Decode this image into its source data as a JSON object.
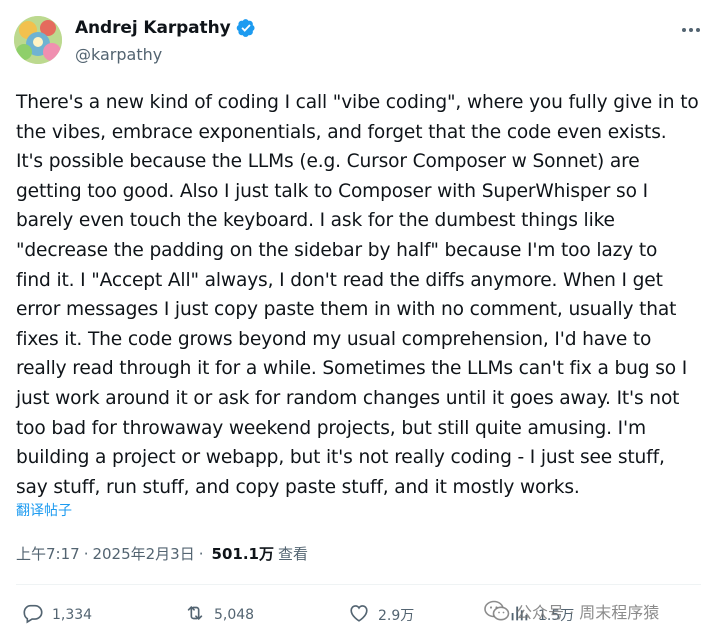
{
  "author": {
    "display_name": "Andrej Karpathy",
    "handle": "@karpathy",
    "verified": true
  },
  "tweet": {
    "lines": [
      "There's a new kind of coding I call \"vibe coding\", where you fully give in to",
      "the vibes, embrace exponentials, and forget that the code even exists.",
      "It's possible because the LLMs (e.g. Cursor Composer w Sonnet) are",
      "getting too good. Also I just talk to Composer with SuperWhisper so I",
      "barely even touch the keyboard. I ask for the dumbest things like",
      "\"decrease the padding on the sidebar by half\" because I'm too lazy to",
      "find it. I \"Accept All\" always, I don't read the diffs anymore. When I get",
      "error messages I just copy paste them in with no comment, usually that",
      "fixes it. The code grows beyond my usual comprehension, I'd have to",
      "really read through it for a while. Sometimes the LLMs can't fix a bug so I",
      "just work around it or ask for random changes until it goes away. It's not",
      "too bad for throwaway weekend projects, but still quite amusing. I'm",
      "building a project or webapp, but it's not really coding - I just see stuff,",
      "say stuff, run stuff, and copy paste stuff, and it mostly works."
    ],
    "translate_label": "翻译帖子",
    "time": "上午7:17",
    "separator": "·",
    "date": "2025年2月3日",
    "views_count": "501.1万",
    "views_label": "查看"
  },
  "actions": {
    "reply_count": "1,334",
    "retweet_count": "5,048",
    "like_count": "2.9万",
    "views_count": "1.5万"
  },
  "watermark": {
    "text": "公众号 · 周末程序猿"
  },
  "colors": {
    "text_primary": "#0f1419",
    "text_secondary": "#536471",
    "link_blue": "#1d9bf0",
    "verified_blue": "#1d9bf0"
  },
  "icons": {
    "more": "more-dots-icon",
    "verified": "verified-badge-icon",
    "reply": "reply-bubble-icon",
    "retweet": "retweet-icon",
    "like": "heart-icon",
    "views": "views-bars-icon",
    "watermark": "wechat-icon"
  }
}
